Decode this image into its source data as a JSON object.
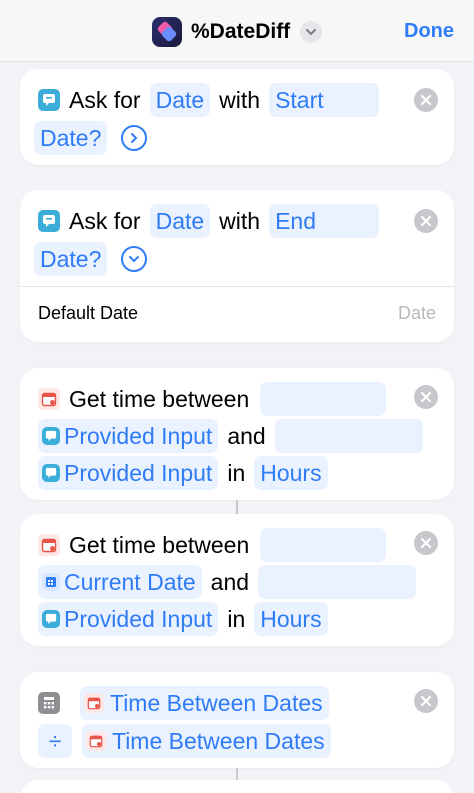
{
  "navbar": {
    "title": "%DateDiff",
    "done_label": "Done"
  },
  "actions": [
    {
      "prefix": "Ask for",
      "type_token": "Date",
      "with": "with",
      "prompt_l1": "Start",
      "prompt_l2": "Date?"
    },
    {
      "prefix": "Ask for",
      "type_token": "Date",
      "with": "with",
      "prompt_l1": "End",
      "prompt_l2": "Date?",
      "default_label": "Default Date",
      "default_placeholder": "Date"
    },
    {
      "prefix": "Get time between",
      "var1": "Provided Input",
      "and": "and",
      "var2": "Provided Input",
      "in": "in",
      "unit": "Hours"
    },
    {
      "prefix": "Get time between",
      "var1": "Current Date",
      "and": "and",
      "var2": "Provided Input",
      "in": "in",
      "unit": "Hours"
    },
    {
      "operand1": "Time Between Dates",
      "operator": "÷",
      "operand2": "Time Between Dates"
    }
  ],
  "colors": {
    "accent": "#2f7cf6",
    "ask_icon": "#3aaed8",
    "date_icon": "#e8534a",
    "calc_icon": "#8e8e93"
  }
}
